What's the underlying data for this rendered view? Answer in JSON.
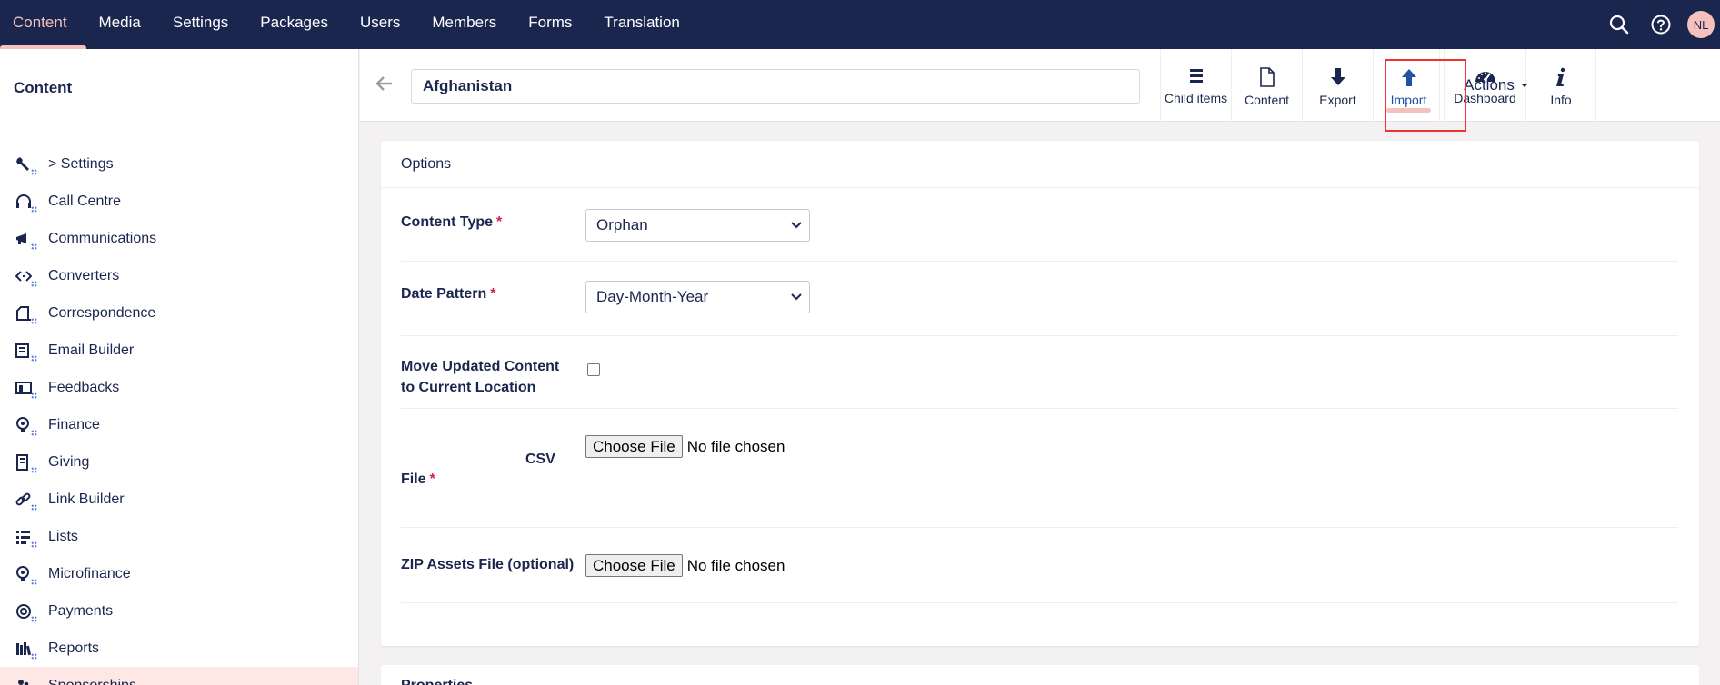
{
  "topnav": {
    "items": [
      "Content",
      "Media",
      "Settings",
      "Packages",
      "Users",
      "Members",
      "Forms",
      "Translation"
    ],
    "active": "Content",
    "avatar_initials": "NL"
  },
  "sidebar": {
    "title": "Content",
    "items": [
      {
        "label": "> Settings",
        "icon": "wrench-icon"
      },
      {
        "label": "Call Centre",
        "icon": "headset-icon"
      },
      {
        "label": "Communications",
        "icon": "megaphone-icon"
      },
      {
        "label": "Converters",
        "icon": "code-arrows-icon"
      },
      {
        "label": "Correspondence",
        "icon": "letter-icon"
      },
      {
        "label": "Email Builder",
        "icon": "newsletter-icon"
      },
      {
        "label": "Feedbacks",
        "icon": "feedback-icon"
      },
      {
        "label": "Finance",
        "icon": "coin-icon"
      },
      {
        "label": "Giving",
        "icon": "receipt-icon"
      },
      {
        "label": "Link Builder",
        "icon": "link-icon"
      },
      {
        "label": "Lists",
        "icon": "list-icon"
      },
      {
        "label": "Microfinance",
        "icon": "coin-icon"
      },
      {
        "label": "Payments",
        "icon": "payment-icon"
      },
      {
        "label": "Reports",
        "icon": "books-icon"
      },
      {
        "label": "Sponsorships",
        "icon": "people-icon"
      }
    ],
    "selected": "Sponsorships"
  },
  "header": {
    "name": "Afghanistan",
    "apps": [
      {
        "label": "Child items",
        "icon": "list-icon"
      },
      {
        "label": "Content",
        "icon": "document-icon"
      },
      {
        "label": "Export",
        "icon": "arrow-down-icon"
      },
      {
        "label": "Import",
        "icon": "arrow-up-icon"
      },
      {
        "label": "Dashboard",
        "icon": "gauge-icon"
      },
      {
        "label": "Info",
        "icon": "info-icon"
      }
    ],
    "active_app": "Import",
    "actions_label": "Actions"
  },
  "options": {
    "title": "Options",
    "content_type": {
      "label": "Content Type",
      "value": "Orphan"
    },
    "date_pattern": {
      "label": "Date Pattern",
      "value": "Day-Month-Year"
    },
    "move_updated": {
      "label_line1": "Move Updated Content",
      "label_line2": "to Current Location",
      "checked": false
    },
    "csv_file": {
      "label_part1": "CSV",
      "label_part2": "File",
      "button": "Choose File",
      "status": "No file chosen"
    },
    "zip_file": {
      "label": "ZIP Assets File (optional)",
      "button": "Choose File",
      "status": "No file chosen"
    },
    "required_mark": "*"
  },
  "next_section": {
    "title": "Properties"
  },
  "colors": {
    "topbar": "#1b264f",
    "accent_pink": "#f5c1bc",
    "active_blue": "#2152a3",
    "required_red": "#d42054",
    "highlight_red": "#ee3333"
  }
}
